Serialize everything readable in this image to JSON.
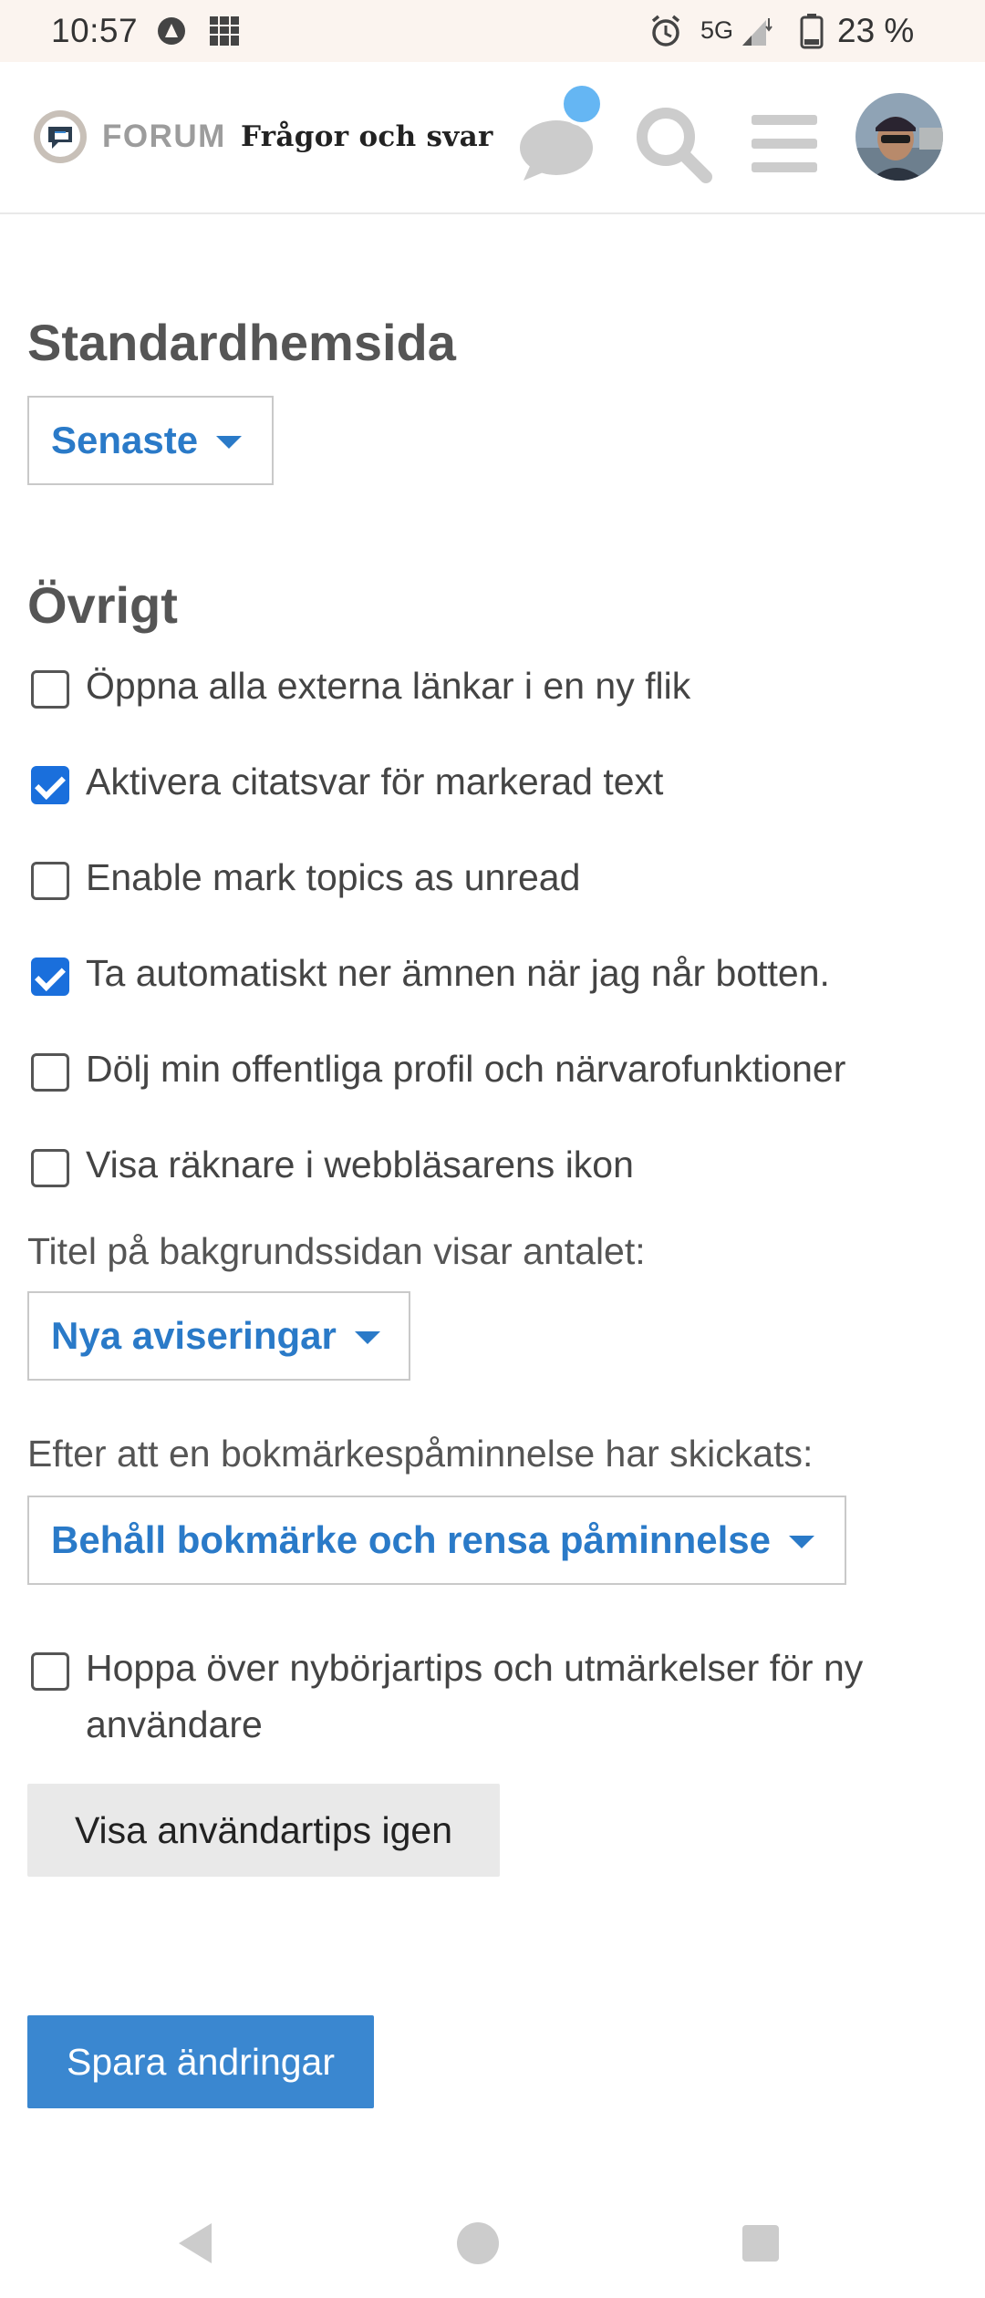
{
  "status_bar": {
    "time": "10:57",
    "network": "5G",
    "battery": "23 %"
  },
  "header": {
    "logo_text": "FORUM",
    "subtitle": "Frågor och svar",
    "accent_color": "#65b6f3"
  },
  "homepage": {
    "title": "Standardhemsida",
    "selected": "Senaste"
  },
  "other": {
    "title": "Övrigt",
    "checkboxes": [
      {
        "label": "Öppna alla externa länkar i en ny flik",
        "checked": false
      },
      {
        "label": "Aktivera citatsvar för markerad text",
        "checked": true
      },
      {
        "label": "Enable mark topics as unread",
        "checked": false
      },
      {
        "label": "Ta automatiskt ner ämnen när jag når botten.",
        "checked": true
      },
      {
        "label": "Dölj min offentliga profil och närvarofunktioner",
        "checked": false
      },
      {
        "label": "Visa räknare i webbläsarens ikon",
        "checked": false
      }
    ],
    "title_count_label": "Titel på bakgrundssidan visar antalet:",
    "title_count_selected": "Nya aviseringar",
    "bookmark_label": "Efter att en bokmärkespåminnelse har skickats:",
    "bookmark_selected": "Behåll bokmärke och rensa påminnelse",
    "skip_tips": {
      "label": "Hoppa över nybörjartips och utmärkelser för ny användare",
      "checked": false
    },
    "show_tips_button": "Visa användartips igen"
  },
  "save_button": "Spara ändringar",
  "colors": {
    "link_blue": "#2a7ac8",
    "primary_button": "#3a87d0",
    "checkbox_checked": "#1a6fdc"
  }
}
